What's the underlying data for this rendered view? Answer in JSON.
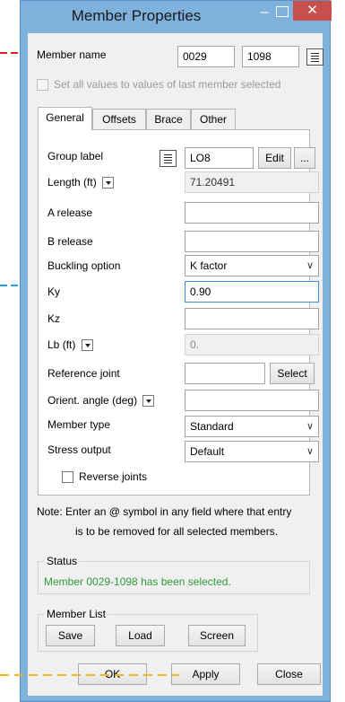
{
  "window": {
    "title": "Member Properties",
    "minimize_glyph": "–",
    "close_glyph": "✕"
  },
  "member_name": {
    "label": "Member name",
    "start_joint": "0029",
    "end_joint": "1098"
  },
  "set_all": {
    "label": "Set all values to values of last member selected",
    "checked": false
  },
  "tabs": [
    {
      "label": "General",
      "active": true
    },
    {
      "label": "Offsets",
      "active": false
    },
    {
      "label": "Brace",
      "active": false
    },
    {
      "label": "Other",
      "active": false
    }
  ],
  "general": {
    "group_label": {
      "label": "Group label",
      "value": "LO8",
      "edit_button": "Edit",
      "more_button": "..."
    },
    "length": {
      "label": "Length",
      "unit": "(ft)",
      "value": "71.20491"
    },
    "a_release": {
      "label": "A release",
      "value": ""
    },
    "b_release": {
      "label": "B release",
      "value": ""
    },
    "buckling_option": {
      "label": "Buckling option",
      "value": "K factor"
    },
    "ky": {
      "label": "Ky",
      "value": "0.90"
    },
    "kz": {
      "label": "Kz",
      "value": ""
    },
    "lb": {
      "label": "Lb",
      "unit": "(ft)",
      "value": "0."
    },
    "reference_joint": {
      "label": "Reference joint",
      "value": "",
      "select_button": "Select"
    },
    "orient_angle": {
      "label": "Orient. angle",
      "unit": "(deg)",
      "value": ""
    },
    "member_type": {
      "label": "Member type",
      "value": "Standard"
    },
    "stress_output": {
      "label": "Stress output",
      "value": "Default"
    },
    "reverse_joints": {
      "label": "Reverse joints",
      "checked": false
    }
  },
  "note": {
    "line1": "Note: Enter an @ symbol in any field where that entry",
    "line2": "is to be removed for all selected members."
  },
  "status": {
    "title": "Status",
    "message": "Member 0029-1098 has been selected.",
    "color": "#2f9a3a"
  },
  "member_list": {
    "title": "Member List",
    "save": "Save",
    "load": "Load",
    "screen": "Screen"
  },
  "footer": {
    "ok": "OK",
    "apply": "Apply",
    "close": "Close"
  },
  "icons": {
    "list": "list-icon",
    "dropdown": "dropdown-arrow-icon"
  },
  "annotation_colors": {
    "red": "#e02020",
    "blue": "#1ea0e6",
    "yellow": "#f1b52a"
  }
}
